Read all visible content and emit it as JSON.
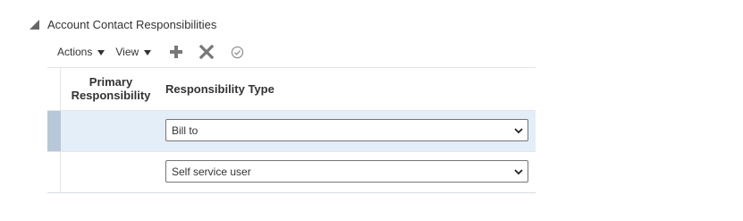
{
  "section": {
    "title": "Account Contact Responsibilities",
    "icon": "collapse-triangle-icon"
  },
  "toolbar": {
    "actions_label": "Actions",
    "view_label": "View",
    "icons": [
      "add-icon",
      "delete-icon",
      "check-circle-icon"
    ]
  },
  "table": {
    "columns": [
      "Primary Responsibility",
      "Responsibility Type"
    ],
    "rows": [
      {
        "responsibility_type": "Bill to",
        "selected": true
      },
      {
        "responsibility_type": "Self service user",
        "selected": false
      }
    ]
  },
  "colors": {
    "selected_row": "#e3eef9",
    "selected_stub": "#b7c8d8",
    "icon_gray": "#777777"
  }
}
